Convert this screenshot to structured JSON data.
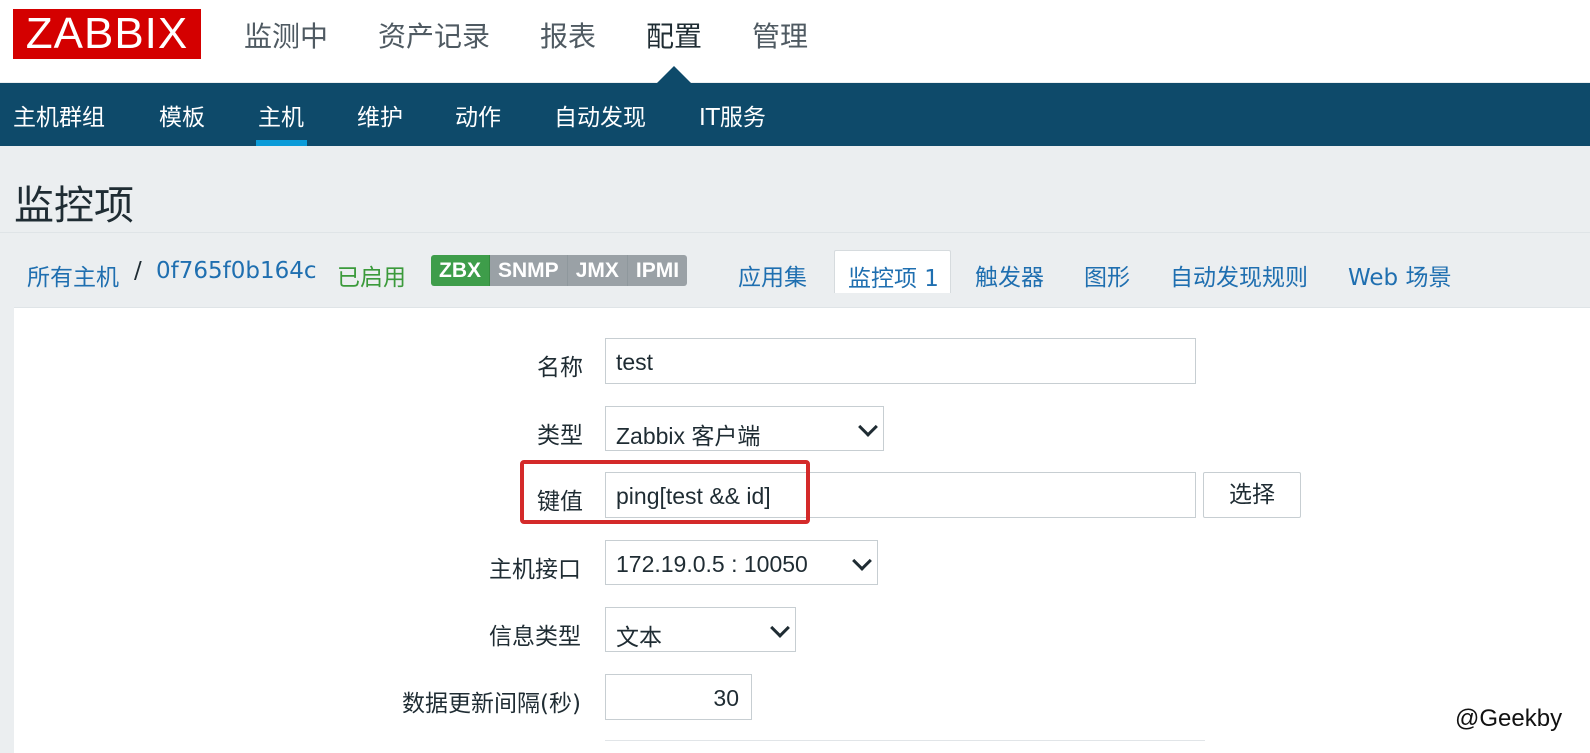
{
  "logo": {
    "text": "ZABBIX"
  },
  "main_nav": [
    "监测中",
    "资产记录",
    "报表",
    "配置",
    "管理"
  ],
  "sub_nav": [
    "主机群组",
    "模板",
    "主机",
    "维护",
    "动作",
    "自动发现",
    "IT服务"
  ],
  "page_title": "监控项",
  "breadcrumb": {
    "all_hosts": "所有主机",
    "separator": "/",
    "host": "0f765f0b164c",
    "status": "已启用",
    "availability": [
      "ZBX",
      "SNMP",
      "JMX",
      "IPMI"
    ]
  },
  "tabs": {
    "applications": "应用集",
    "items": "监控项 1",
    "triggers": "触发器",
    "graphs": "图形",
    "discovery": "自动发现规则",
    "web": "Web 场景"
  },
  "form": {
    "name_label": "名称",
    "name_value": "test",
    "type_label": "类型",
    "type_value": "Zabbix 客户端",
    "key_label": "键值",
    "key_value": "ping[test && id]",
    "select_button": "选择",
    "interface_label": "主机接口",
    "interface_value": "172.19.0.5 : 10050",
    "info_type_label": "信息类型",
    "info_type_value": "文本",
    "interval_label": "数据更新间隔(秒)",
    "interval_value": "30"
  },
  "watermark": "@Geekby",
  "colors": {
    "logo_red": "#d40000",
    "nav_blue": "#0e4a6a",
    "link_blue": "#1f6fb0",
    "enabled_green": "#3b9a3b",
    "highlight_red": "#d42a2a"
  }
}
